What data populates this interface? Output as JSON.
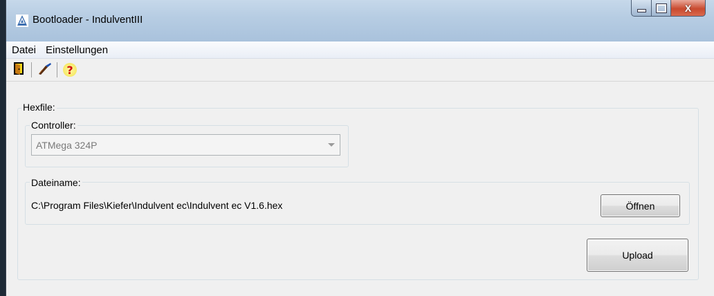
{
  "window": {
    "title": "Bootloader - IndulventIII",
    "icon": "app-tree-icon",
    "controls": {
      "minimize": "minimize-icon",
      "maximize": "maximize-icon",
      "close": "close-icon",
      "close_glyph": "X"
    }
  },
  "menu": {
    "items": [
      {
        "label": "Datei"
      },
      {
        "label": "Einstellungen"
      }
    ]
  },
  "toolbar": {
    "buttons": [
      {
        "icon": "exit-door-icon"
      },
      {
        "icon": "programmer-wand-icon"
      },
      {
        "icon": "help-question-icon",
        "glyph": "?"
      }
    ]
  },
  "hexfile": {
    "label": "Hexfile:",
    "controller": {
      "label": "Controller:",
      "selected": "ATMega 324P"
    },
    "dateiname": {
      "label": "Dateiname:",
      "path": "C:\\Program Files\\Kiefer\\Indulvent ec\\Indulvent ec V1.6.hex",
      "open_button": "Öffnen"
    },
    "upload_button": "Upload"
  },
  "colors": {
    "titlebar": "#b7cde3",
    "window_bg": "#f0f0f0",
    "close_button": "#c94a2f"
  }
}
